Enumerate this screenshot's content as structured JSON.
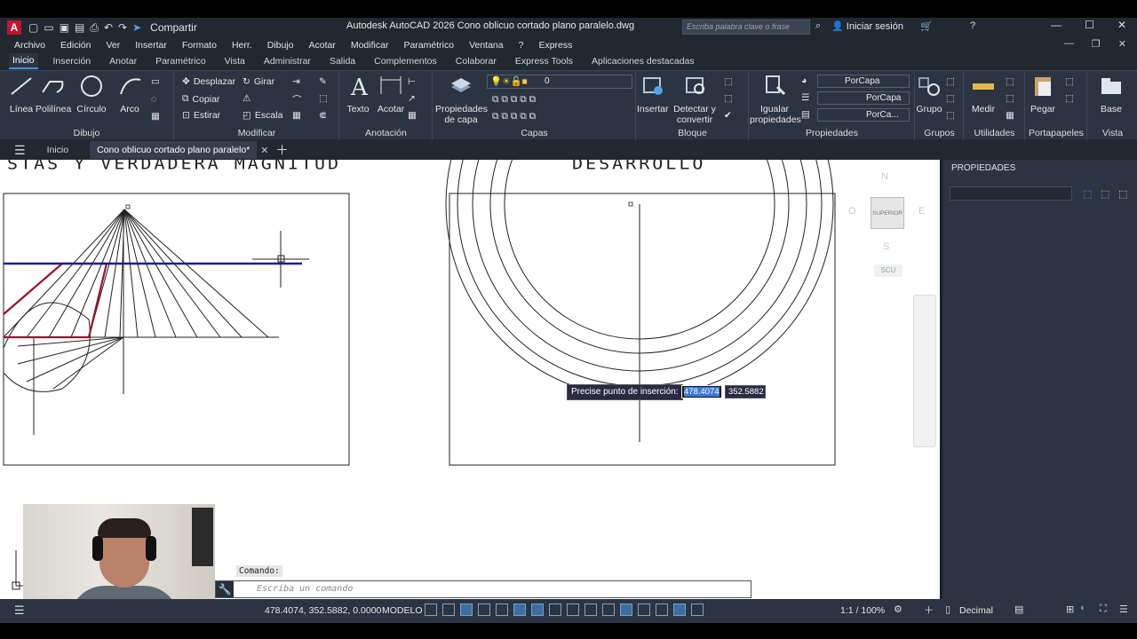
{
  "app": {
    "logo": "A",
    "title": "Autodesk AutoCAD 2026    Cono oblicuo cortado plano paralelo.dwg",
    "share_label": "Compartir",
    "search_placeholder": "Escriba palabra clave o frase",
    "signin_label": "Iniciar sesión"
  },
  "menubar": [
    "Archivo",
    "Edición",
    "Ver",
    "Insertar",
    "Formato",
    "Herr.",
    "Dibujo",
    "Acotar",
    "Modificar",
    "Paramétrico",
    "Ventana",
    "?",
    "Express"
  ],
  "ribbon_tabs": [
    "Inicio",
    "Inserción",
    "Anotar",
    "Paramétrico",
    "Vista",
    "Administrar",
    "Salida",
    "Complementos",
    "Colaborar",
    "Express Tools",
    "Aplicaciones destacadas"
  ],
  "ribbon": {
    "dibujo": {
      "footer": "Dibujo",
      "linea": "Línea",
      "polilinea": "Polilínea",
      "circulo": "Círculo",
      "arco": "Arco"
    },
    "modificar": {
      "footer": "Modificar",
      "desplazar": "Desplazar",
      "girar": "Girar",
      "copiar": "Copiar",
      "estirar": "Estirar",
      "escala": "Escala"
    },
    "anotacion": {
      "footer": "Anotación",
      "texto": "Texto",
      "acotar": "Acotar"
    },
    "capas": {
      "footer": "Capas",
      "propiedades_capa": "Propiedades de capa",
      "layer_value": "0"
    },
    "bloque": {
      "footer": "Bloque",
      "insertar": "Insertar",
      "detectar": "Detectar y convertir"
    },
    "propiedades": {
      "footer": "Propiedades",
      "igualar": "Igualar propiedades",
      "color": "PorCapa",
      "linetype": "PorCapa",
      "lineweight": "PorCa..."
    },
    "grupos": {
      "footer": "Grupos",
      "grupo": "Grupo"
    },
    "utilidades": {
      "footer": "Utilidades",
      "medir": "Medir"
    },
    "portapapeles": {
      "footer": "Portapapeles",
      "pegar": "Pegar"
    },
    "vista": {
      "footer": "Vista",
      "base": "Base"
    }
  },
  "file_tabs": {
    "start": "Inicio",
    "active": "Cono oblicuo cortado plano paralelo*"
  },
  "drawing": {
    "header_left": "STAS Y VERDADERA MAGNITUD",
    "header_right": "DESARROLLO"
  },
  "viewcube": {
    "north": "N",
    "south": "S",
    "east": "E",
    "west": "O",
    "face": "SUPERIOR",
    "ucs": "SCU"
  },
  "dynamic_input": {
    "prompt": "Precise punto de inserción:",
    "x": "478.4074",
    "y": "352.5882"
  },
  "properties_panel": {
    "title": "PROPIEDADES"
  },
  "command": {
    "label": "Comando:",
    "placeholder": "Escriba un comando"
  },
  "statusbar": {
    "coords": "478.4074, 352.5882, 0.0000",
    "space": "MODELO",
    "scale": "1:1 / 100%",
    "units": "Decimal"
  },
  "colors": {
    "accent": "#4a90d9",
    "line_blue": "#1a1aa8",
    "line_red": "#a01030"
  }
}
